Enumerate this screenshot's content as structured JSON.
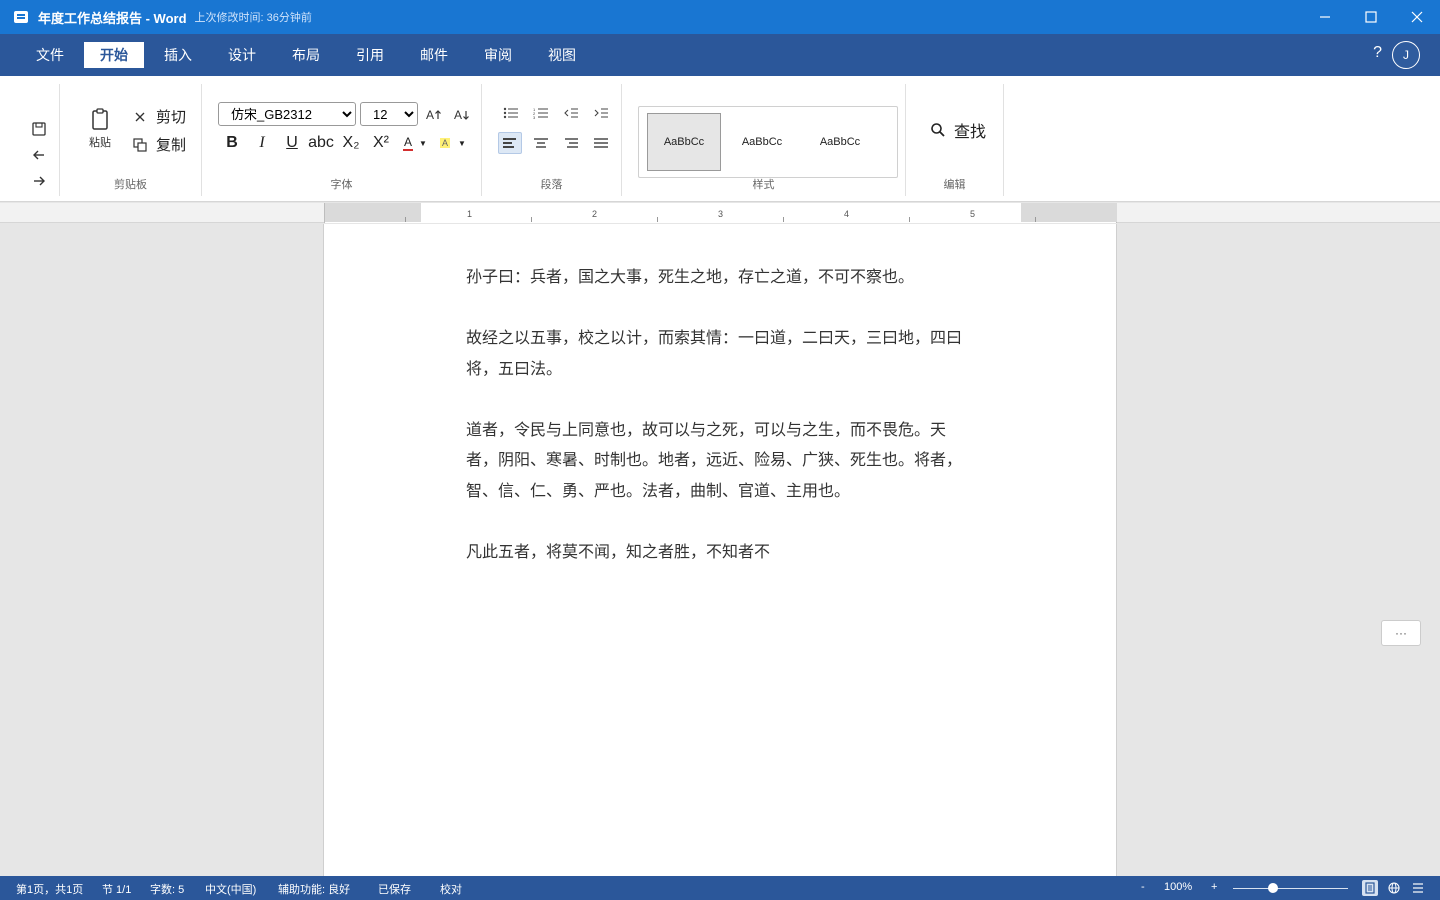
{
  "titlebar": {
    "doc_title": "年度工作总结报告 - Word",
    "last_modified": "上次修改时间: 36分钟前",
    "icons": [
      "word-icon",
      "minimize-icon",
      "maximize-icon",
      "close-icon"
    ]
  },
  "menubar": {
    "tabs": [
      "文件",
      "开始",
      "插入",
      "设计",
      "布局",
      "引用",
      "邮件",
      "审阅",
      "视图"
    ],
    "active_tab": "开始",
    "help": "?",
    "avatar_initial": "J"
  },
  "ribbon": {
    "clipboard": {
      "group_label": "剪贴板",
      "paste": "粘贴",
      "cut": "剪切",
      "copy": "复制"
    },
    "font": {
      "group_label": "字体",
      "font_name": "仿宋_GB2312",
      "font_size": "12",
      "bold": "B",
      "italic": "I",
      "underline": "U",
      "strikethrough": "abc",
      "subscript": "X₂",
      "superscript": "X²",
      "font_color_letter": "A",
      "highlight_letter": "A"
    },
    "paragraph": {
      "group_label": "段落"
    },
    "styles": {
      "group_label": "样式",
      "items": [
        "AaBbCc",
        "AaBbCc",
        "AaBbCc"
      ]
    },
    "editing": {
      "group_label": "编辑",
      "find": "查找"
    }
  },
  "ruler": {
    "numbers": [
      "1",
      "2",
      "3",
      "4",
      "5"
    ]
  },
  "document": {
    "paragraphs": [
      "孙子曰：兵者，国之大事，死生之地，存亡之道，不可不察也。",
      "故经之以五事，校之以计，而索其情：一曰道，二曰天，三曰地，四曰将，五曰法。",
      "道者，令民与上同意也，故可以与之死，可以与之生，而不畏危。天者，阴阳、寒暑、时制也。地者，远近、险易、广狭、死生也。将者，智、信、仁、勇、严也。法者，曲制、官道、主用也。",
      "凡此五者，将莫不闻，知之者胜，不知者不"
    ]
  },
  "more_button": "···",
  "statusbar": {
    "page": "第1页，共1页",
    "section": "节 1/1",
    "word_count": "字数: 5",
    "language": "中文(中国)",
    "accessibility": "辅助功能: 良好",
    "saved": "已保存",
    "proofing": "校对",
    "zoom_minus": "-",
    "zoom_level": "100%",
    "zoom_plus": "+",
    "zoom_fraction": 0.3
  },
  "colors": {
    "titlebar": "#1976d2",
    "menubar": "#2b579a",
    "statusbar": "#2b579a",
    "font_color": "#d32f2f",
    "highlight": "#fff176"
  }
}
